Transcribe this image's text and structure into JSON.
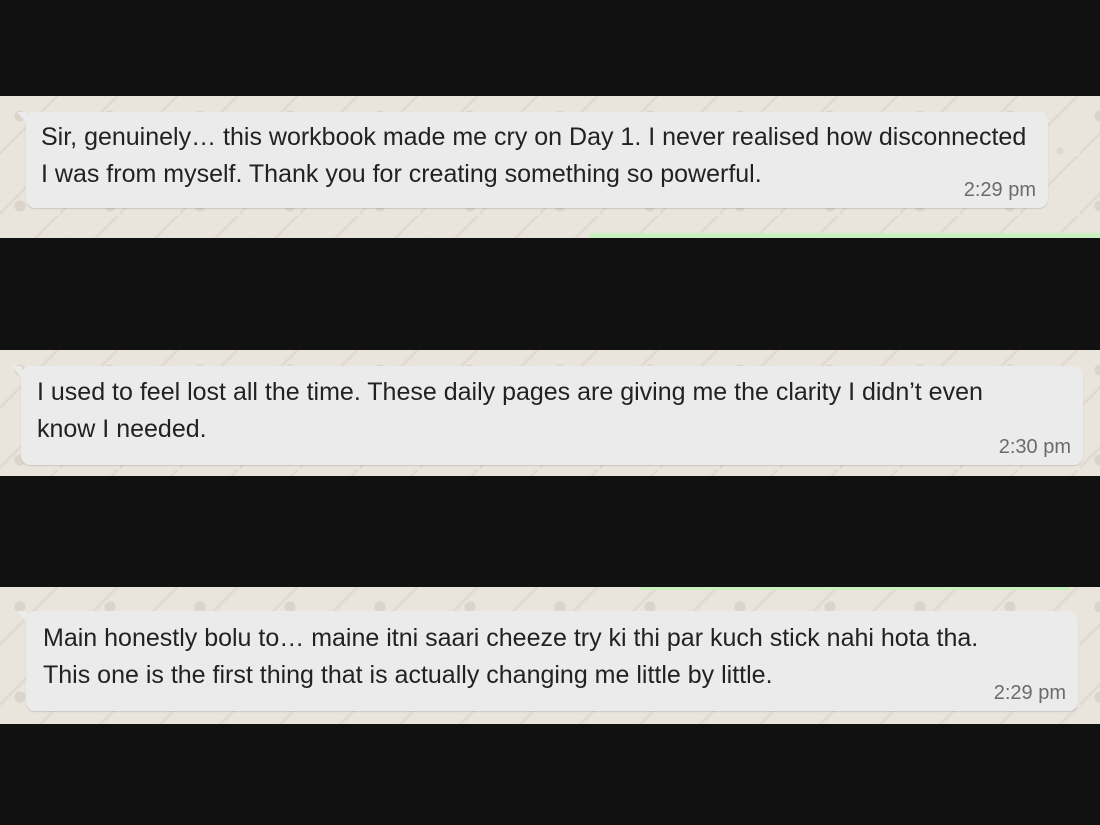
{
  "messages": [
    {
      "text": "Sir, genuinely… this workbook made me cry on Day 1. I never realised how disconnected\nI was from myself. Thank you for creating something so powerful.",
      "time": "2:29 pm"
    },
    {
      "text": "I used to feel lost all the time. These daily pages are giving me the clarity I didn’t even\nknow I needed.",
      "time": "2:30 pm"
    },
    {
      "text": "Main honestly bolu to… maine itni saari cheeze try ki thi par kuch stick nahi hota tha.\nThis one is the first thing that is actually changing me little by little.",
      "time": "2:29 pm"
    }
  ],
  "colors": {
    "background": "#111111",
    "chat_wallpaper": "#e9e4dc",
    "bubble": "#ebebeb",
    "text": "#222222",
    "timestamp": "#6b6b6b",
    "sent_accent": "#c9f0bf"
  }
}
